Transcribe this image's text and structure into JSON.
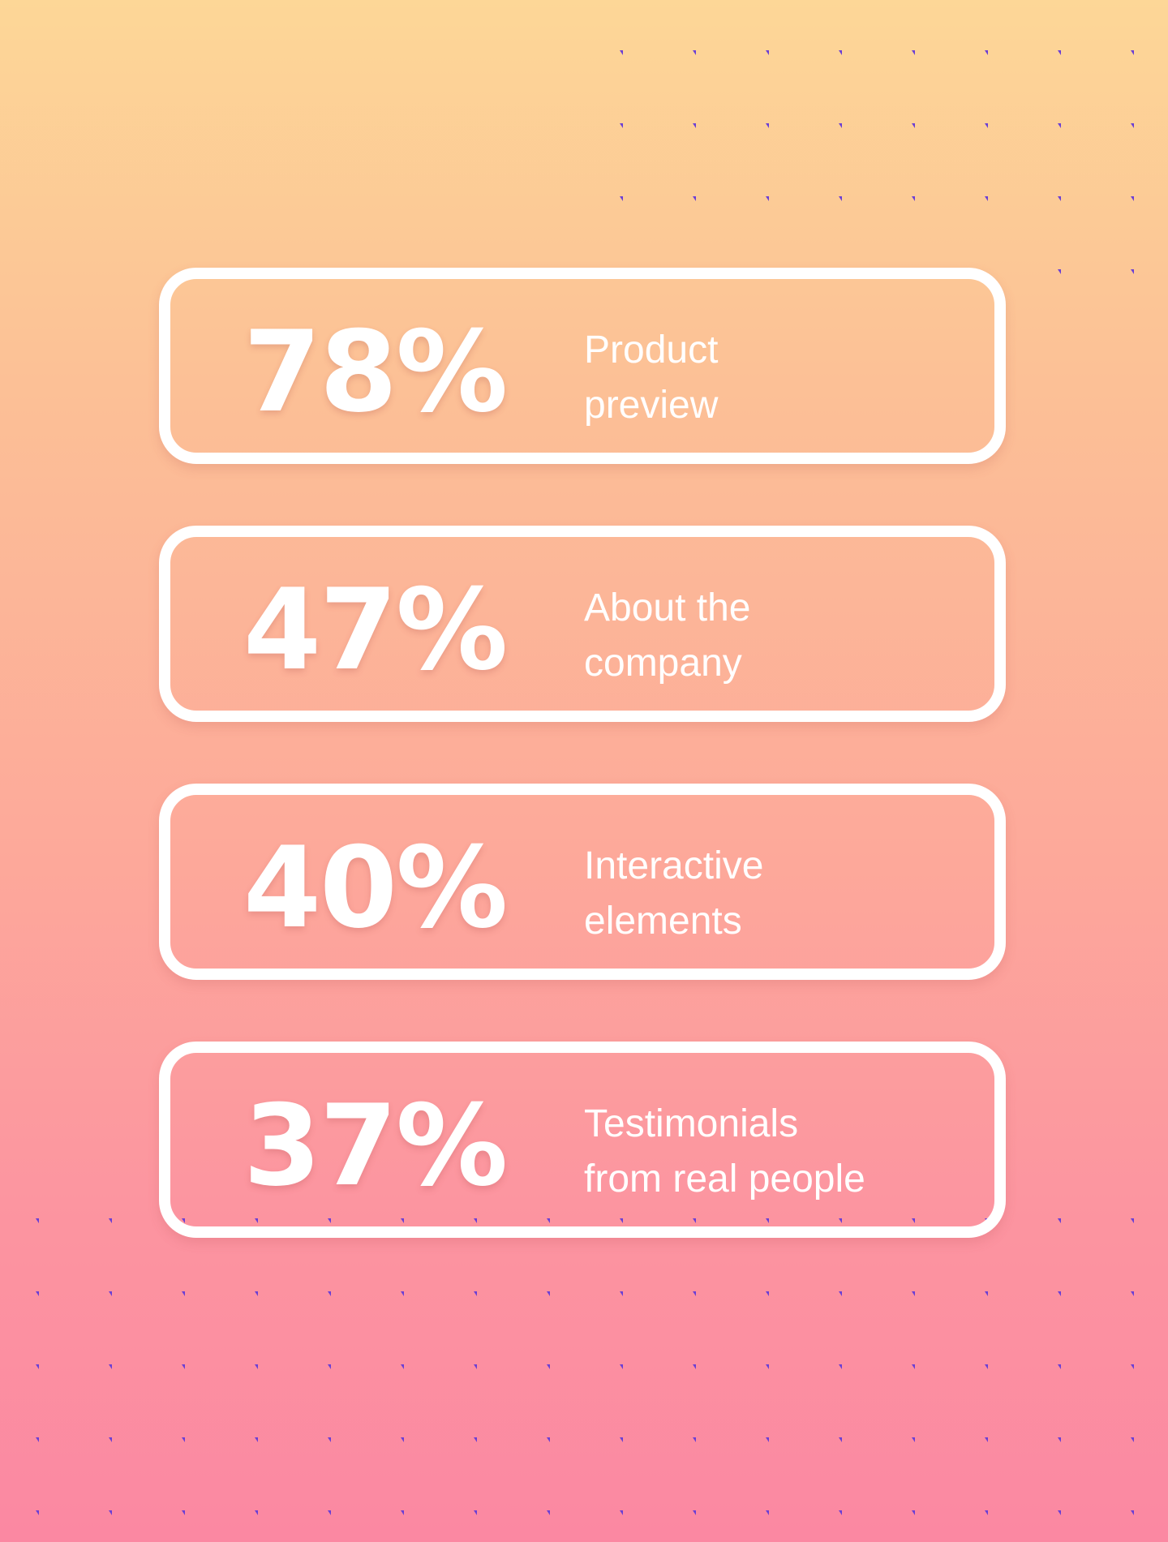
{
  "stats": [
    {
      "value": "78%",
      "label": "Product\npreview"
    },
    {
      "value": "47%",
      "label": "About the\ncompany"
    },
    {
      "value": "40%",
      "label": "Interactive\nelements"
    },
    {
      "value": "37%",
      "label": "Testimonials\nfrom real people"
    }
  ],
  "colors": {
    "gradient_top": "#fdd797",
    "gradient_bottom": "#fb88a2",
    "card_border": "#ffffff",
    "dot": "#6b3fd4"
  }
}
